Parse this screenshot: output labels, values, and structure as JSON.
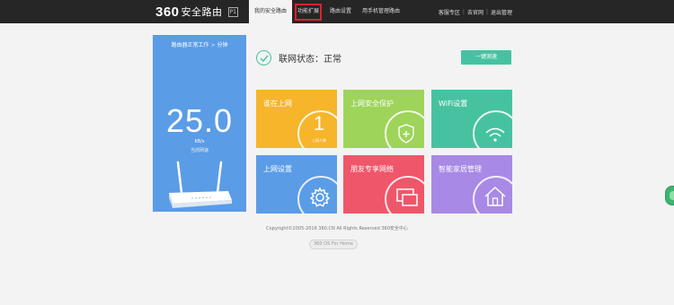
{
  "header": {
    "logo_number": "360",
    "logo_text": "安全路由",
    "logo_badge": "P1",
    "nav": [
      {
        "label": "我的安全路由",
        "active": true
      },
      {
        "label": "功能扩展",
        "highlighted": true
      },
      {
        "label": "路由设置"
      },
      {
        "label": "用手机管理路由"
      }
    ],
    "links": [
      "客服专区",
      "去官网",
      "退出管理"
    ]
  },
  "speed_panel": {
    "uptime_prefix": "路由器正常工作",
    "uptime_arrow": ">",
    "uptime_value": "分钟",
    "speed_value": "25.0",
    "speed_unit": "KB/s",
    "speed_label": "当前网速"
  },
  "status": {
    "text": "联网状态：正常",
    "speedtest_button": "一键测速"
  },
  "tiles": [
    {
      "label": "谁在上网",
      "count": "1",
      "count_label": "上网人数",
      "icon": "user-count"
    },
    {
      "label": "上网安全保护",
      "icon": "shield-plus-icon"
    },
    {
      "label": "WiFi设置",
      "icon": "wifi-icon"
    },
    {
      "label": "上网设置",
      "icon": "gear-icon"
    },
    {
      "label": "朋友专享网络",
      "icon": "window-icon"
    },
    {
      "label": "智能家居管理",
      "icon": "house-icon"
    }
  ],
  "footer": {
    "copyright": "Copyright©2005-2016 360.CN All Rights Reserved 360安全中心",
    "os_badge": "360 OS For Home"
  },
  "colors": {
    "topbar": "#262626",
    "accent_green": "#47c2a1",
    "tile_orange": "#f6b52a",
    "tile_lime": "#9ed45a",
    "tile_blue": "#5b9ce6",
    "tile_red": "#f0566a",
    "tile_purple": "#a889e6",
    "highlight_red": "#d9232e"
  }
}
